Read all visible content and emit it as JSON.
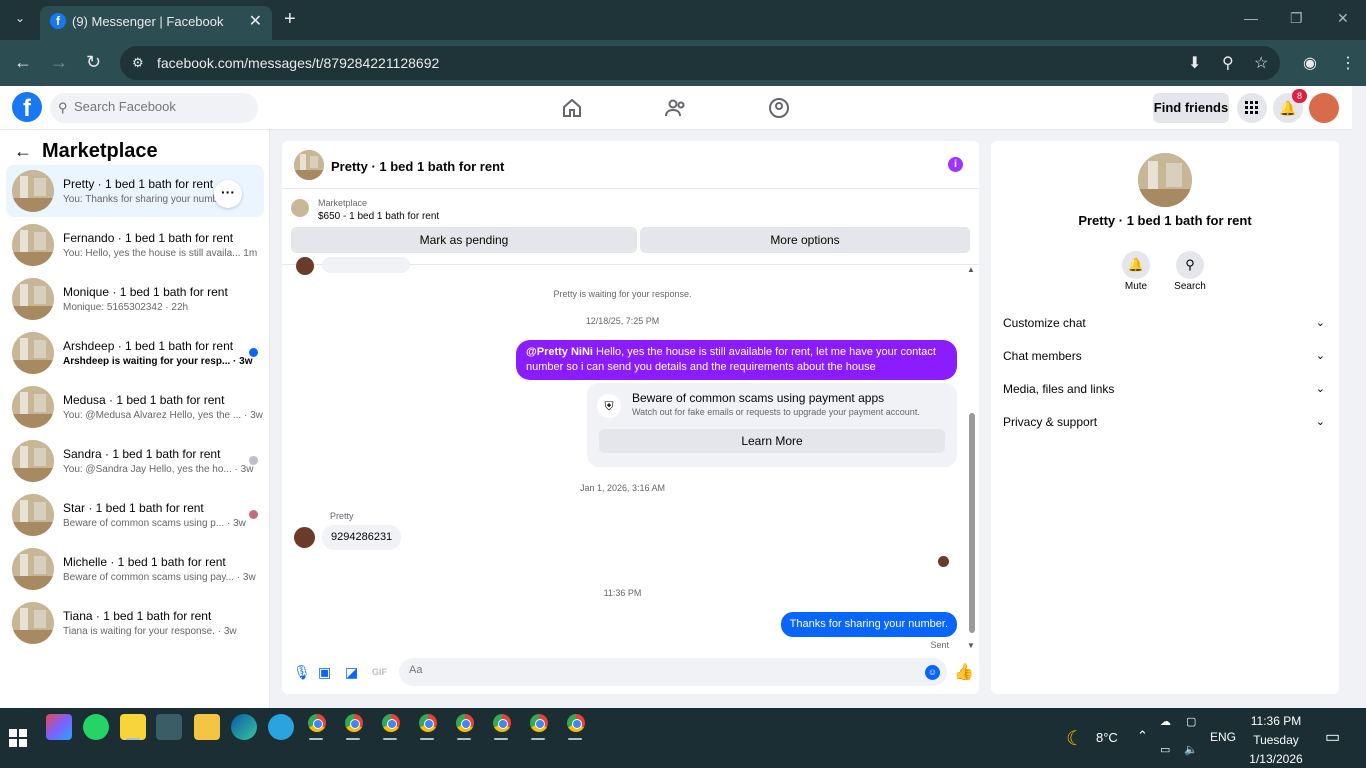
{
  "browser": {
    "tab_title": "(9) Messenger | Facebook",
    "url": "facebook.com/messages/t/879284221128692"
  },
  "fb": {
    "search_placeholder": "Search Facebook",
    "find_friends": "Find friends",
    "notifications_badge": "8"
  },
  "left": {
    "title": "Marketplace",
    "conversations": [
      {
        "name": "Pretty · 1 bed 1 bath for rent",
        "snippet": "You: Thanks for sharing your number.",
        "time": ""
      },
      {
        "name": "Fernando · 1 bed 1 bath for rent",
        "snippet": "You: Hello, yes the house is still availa...",
        "time": "1m"
      },
      {
        "name": "Monique · 1 bed 1 bath for rent",
        "snippet": "Monique: 5165302342",
        "time": "22h"
      },
      {
        "name": "Arshdeep · 1 bed 1 bath for rent",
        "snippet": "Arshdeep is waiting for your resp...",
        "time": "3w"
      },
      {
        "name": "Medusa · 1 bed 1 bath for rent",
        "snippet": "You: @Medusa Alvarez Hello, yes the ...",
        "time": "3w"
      },
      {
        "name": "Sandra · 1 bed 1 bath for rent",
        "snippet": "You: @Sandra Jay Hello, yes the ho...",
        "time": "3w"
      },
      {
        "name": "Star · 1 bed 1 bath for rent",
        "snippet": "Beware of common scams using p...",
        "time": "3w"
      },
      {
        "name": "Michelle · 1 bed 1 bath for rent",
        "snippet": "Beware of common scams using pay...",
        "time": "3w"
      },
      {
        "name": "Tiana · 1 bed 1 bath for rent",
        "snippet": "Tiana is waiting for your response.",
        "time": "3w"
      }
    ]
  },
  "chat": {
    "title": "Pretty · 1 bed 1 bath for rent",
    "marketplace_label": "Marketplace",
    "listing": "$650 - 1 bed 1 bath for rent",
    "mark_pending": "Mark as pending",
    "more_options": "More options",
    "waiting_note": "Pretty is waiting for your response.",
    "ts1": "12/18/25, 7:25 PM",
    "msg1_mention": "@Pretty NiNi",
    "msg1_text": " Hello, yes the house is still available for rent, let me have your contact number so i can send you details and the requirements about the house",
    "scam_title": "Beware of common scams using payment apps",
    "scam_desc": "Watch out for fake emails or requests to upgrade your payment account.",
    "learn_more": "Learn More",
    "ts2": "Jan 1, 2026, 3:16 AM",
    "sender": "Pretty",
    "msg2": "9294286231",
    "ts3": "11:36 PM",
    "msg3": "Thanks for sharing your number.",
    "sent": "Sent",
    "composer_placeholder": "Aa"
  },
  "right": {
    "name": "Pretty · 1 bed 1 bath for rent",
    "mute": "Mute",
    "search": "Search",
    "sections": [
      "Customize chat",
      "Chat members",
      "Media, files and links",
      "Privacy & support"
    ]
  },
  "taskbar": {
    "temp": "8°C",
    "lang": "ENG",
    "time": "11:36 PM",
    "day": "Tuesday",
    "date": "1/13/2026"
  },
  "colors": {
    "fb_blue": "#1877f2",
    "purple_bubble": "#8b1cff",
    "blue_bubble": "#0866ff",
    "unread_dot": "#0866ff"
  }
}
